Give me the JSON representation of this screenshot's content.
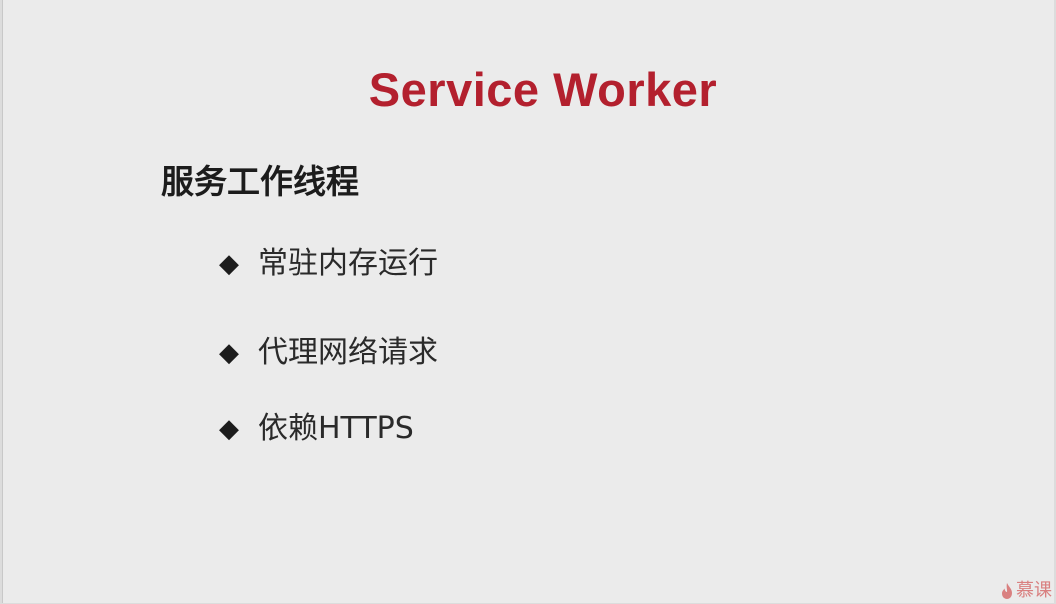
{
  "slide": {
    "title": "Service Worker",
    "subtitle": "服务工作线程",
    "bullet_symbol": "◆",
    "bullets": [
      "常驻内存运行",
      "代理网络请求",
      "依赖HTTPS"
    ],
    "watermark": {
      "icon": "flame-icon",
      "text": "慕课"
    },
    "colors": {
      "title": "#b3202e",
      "background": "#ebebeb",
      "watermark": "#d98080"
    }
  }
}
